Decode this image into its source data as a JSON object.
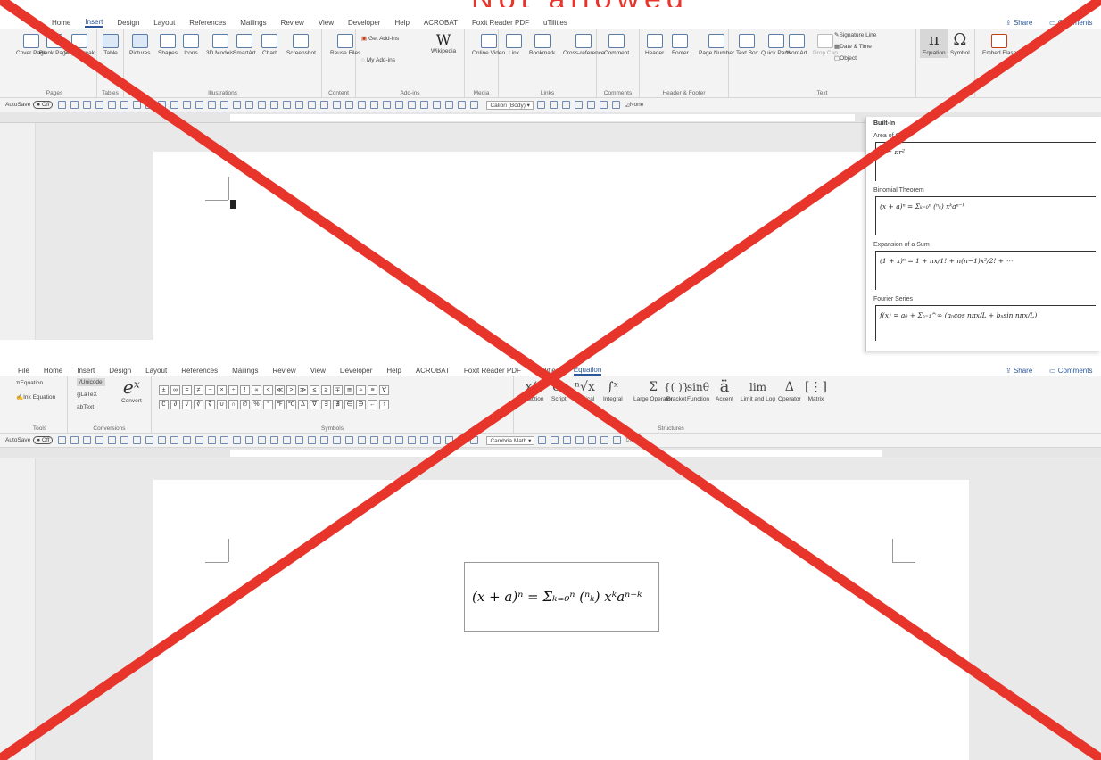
{
  "watermark_text": "Not allowed",
  "top": {
    "tabs": [
      "Home",
      "Insert",
      "Design",
      "Layout",
      "References",
      "Mailings",
      "Review",
      "View",
      "Developer",
      "Help",
      "ACROBAT",
      "Foxit Reader PDF",
      "uTilities"
    ],
    "share": "Share",
    "comments": "Comments",
    "groups": {
      "pages": "Pages",
      "tables": "Tables",
      "illustrations": "Illustrations",
      "content": "Content",
      "addins": "Add-ins",
      "media": "Media",
      "links": "Links",
      "comments": "Comments",
      "headerfooter": "Header & Footer",
      "text": "Text",
      "symbols": "Symbols",
      "flash": ""
    },
    "buttons": {
      "cover": "Cover Page",
      "blank": "Blank Page",
      "pagebreak": "Page Break",
      "table": "Table",
      "pictures": "Pictures",
      "shapes": "Shapes",
      "icons": "Icons",
      "models": "3D Models",
      "smartart": "SmartArt",
      "chart": "Chart",
      "screenshot": "Screenshot",
      "reuse": "Reuse Files",
      "getaddins": "Get Add-ins",
      "myaddins": "My Add-ins",
      "wikipedia": "Wikipedia",
      "video": "Online Video",
      "link": "Link",
      "bookmark": "Bookmark",
      "crossref": "Cross-reference",
      "comment": "Comment",
      "header": "Header",
      "footer": "Footer",
      "pagenumber": "Page Number",
      "textbox": "Text Box",
      "quickparts": "Quick Parts",
      "wordart": "WordArt",
      "dropcap": "Drop Cap",
      "signature": "Signature Line",
      "datetime": "Date & Time",
      "object": "Object",
      "equation": "Equation",
      "symbol": "Symbol",
      "embedflash": "Embed Flash"
    },
    "qat": {
      "autosave": "AutoSave",
      "toggle": "Off",
      "font": "Calibri (Body)",
      "none": "None"
    },
    "panel": {
      "heading": "Built-In",
      "items": [
        {
          "name": "Area of Circle",
          "formula": "A = πr²"
        },
        {
          "name": "Binomial Theorem",
          "formula": "(x + a)ⁿ = Σₖ₌₀ⁿ (ⁿₖ) xᵏaⁿ⁻ᵏ"
        },
        {
          "name": "Expansion of a Sum",
          "formula": "(1 + x)ⁿ = 1 + nx/1! + n(n−1)x²/2! + ⋯"
        },
        {
          "name": "Fourier Series",
          "formula": "f(x) = a₀ + Σₙ₌₁^∞ (aₙcos nπx/L + bₙsin nπx/L)"
        }
      ]
    }
  },
  "bottom": {
    "tabs": [
      "File",
      "Home",
      "Insert",
      "Design",
      "Layout",
      "References",
      "Mailings",
      "Review",
      "View",
      "Developer",
      "Help",
      "ACROBAT",
      "Foxit Reader PDF",
      "uTilities",
      "Equation"
    ],
    "share": "Share",
    "comments": "Comments",
    "buttons": {
      "equation": "Equation",
      "inkeq": "Ink Equation",
      "unicode": "Unicode",
      "latex": "LaTeX",
      "text": "Text",
      "convert": "Convert",
      "fraction": "Fraction",
      "script": "Script",
      "radical": "Radical",
      "integral": "Integral",
      "largeop": "Large Operator",
      "bracket": "Bracket",
      "function": "Function",
      "accent": "Accent",
      "limitlog": "Limit and Log",
      "operator": "Operator",
      "matrix": "Matrix"
    },
    "groups": {
      "tools": "Tools",
      "conversions": "Conversions",
      "symbols": "Symbols",
      "structures": "Structures"
    },
    "qat": {
      "autosave": "AutoSave",
      "toggle": "Off",
      "font": "Cambria Math",
      "none": "None"
    },
    "formula": "(x + a)ⁿ = Σₖ₌₀ⁿ (ⁿₖ) xᵏaⁿ⁻ᵏ"
  },
  "colors": {
    "cross": "#e8352c",
    "accent": "#2b579a",
    "ribbon": "#f3f3f3",
    "canvas": "#e9e9e9"
  }
}
